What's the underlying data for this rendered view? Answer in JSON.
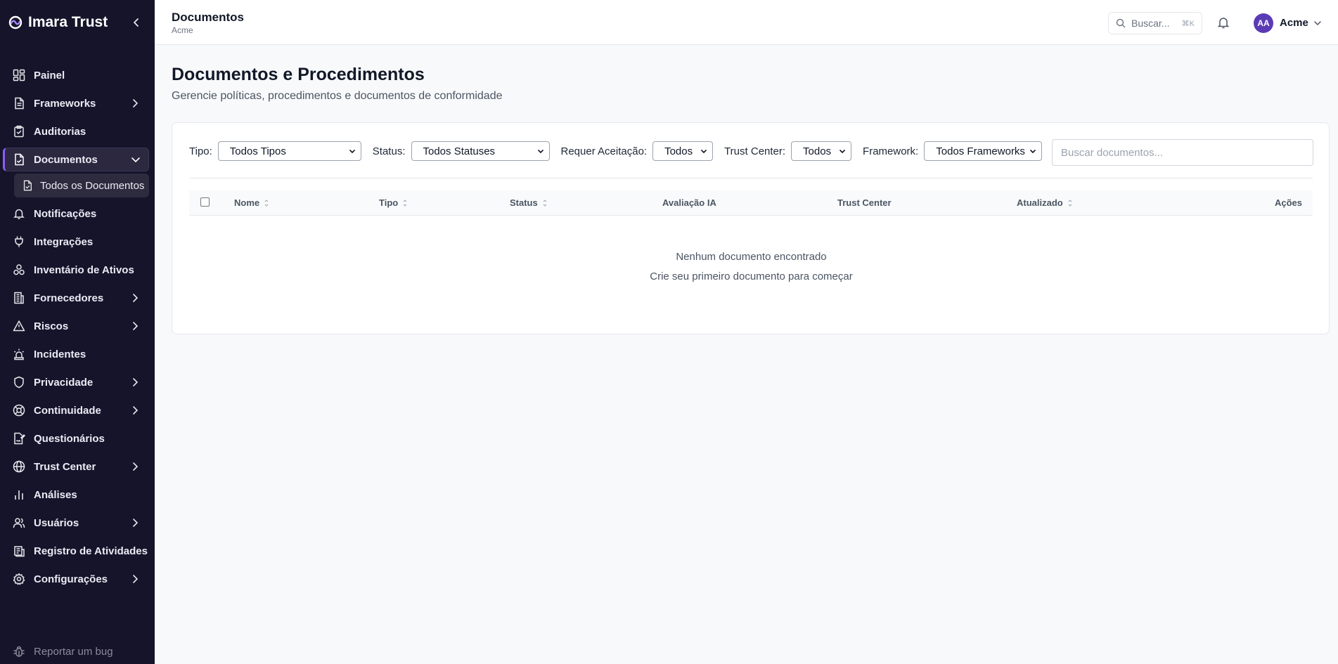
{
  "brand": {
    "name": "Imara Trust"
  },
  "sidebar": {
    "items": [
      {
        "label": "Painel",
        "icon": "dashboard-grid-icon",
        "chevron": false
      },
      {
        "label": "Frameworks",
        "icon": "file-text-icon",
        "chevron": true
      },
      {
        "label": "Auditorias",
        "icon": "clipboard-check-icon",
        "chevron": false
      },
      {
        "label": "Documentos",
        "icon": "file-check-icon",
        "chevron": true,
        "active": true,
        "expanded": true
      },
      {
        "label": "Notificações",
        "icon": "bell-icon",
        "chevron": false
      },
      {
        "label": "Integrações",
        "icon": "plug-icon",
        "chevron": false
      },
      {
        "label": "Inventário de Ativos",
        "icon": "boxes-icon",
        "chevron": false
      },
      {
        "label": "Fornecedores",
        "icon": "building-icon",
        "chevron": true
      },
      {
        "label": "Riscos",
        "icon": "warning-triangle-icon",
        "chevron": true
      },
      {
        "label": "Incidentes",
        "icon": "siren-icon",
        "chevron": false
      },
      {
        "label": "Privacidade",
        "icon": "shield-icon",
        "chevron": true
      },
      {
        "label": "Continuidade",
        "icon": "lifebuoy-icon",
        "chevron": true
      },
      {
        "label": "Questionários",
        "icon": "file-signature-icon",
        "chevron": false
      },
      {
        "label": "Trust Center",
        "icon": "globe-icon",
        "chevron": true
      },
      {
        "label": "Análises",
        "icon": "bar-chart-icon",
        "chevron": false
      },
      {
        "label": "Usuários",
        "icon": "users-icon",
        "chevron": true
      },
      {
        "label": "Registro de Atividades",
        "icon": "activity-log-icon",
        "chevron": false
      },
      {
        "label": "Configurações",
        "icon": "gear-icon",
        "chevron": true
      }
    ],
    "sub_item": {
      "label": "Todos os Documentos",
      "icon": "file-check-icon"
    },
    "report_bug": "Reportar um bug"
  },
  "header": {
    "title": "Documentos",
    "org": "Acme",
    "search_label": "Buscar...",
    "search_shortcut": "⌘K",
    "avatar_initials": "AA",
    "user_name": "Acme"
  },
  "main": {
    "title": "Documentos e Procedimentos",
    "description": "Gerencie políticas, procedimentos e documentos de conformidade",
    "filters": [
      {
        "label": "Tipo:",
        "value": "Todos Tipos"
      },
      {
        "label": "Status:",
        "value": "Todos Statuses"
      },
      {
        "label": "Requer Aceitação:",
        "value": "Todos"
      },
      {
        "label": "Trust Center:",
        "value": "Todos"
      },
      {
        "label": "Framework:",
        "value": "Todos Frameworks"
      }
    ],
    "search_placeholder": "Buscar documentos...",
    "columns": [
      "Nome",
      "Tipo",
      "Status",
      "Avaliação IA",
      "Trust Center",
      "Atualizado",
      "Ações"
    ],
    "empty_title": "Nenhum documento encontrado",
    "empty_subtitle": "Crie seu primeiro documento para começar"
  },
  "colors": {
    "sidebar_bg": "#16142a",
    "accent": "#8b5cf6",
    "avatar_bg": "#5b3bb5"
  }
}
